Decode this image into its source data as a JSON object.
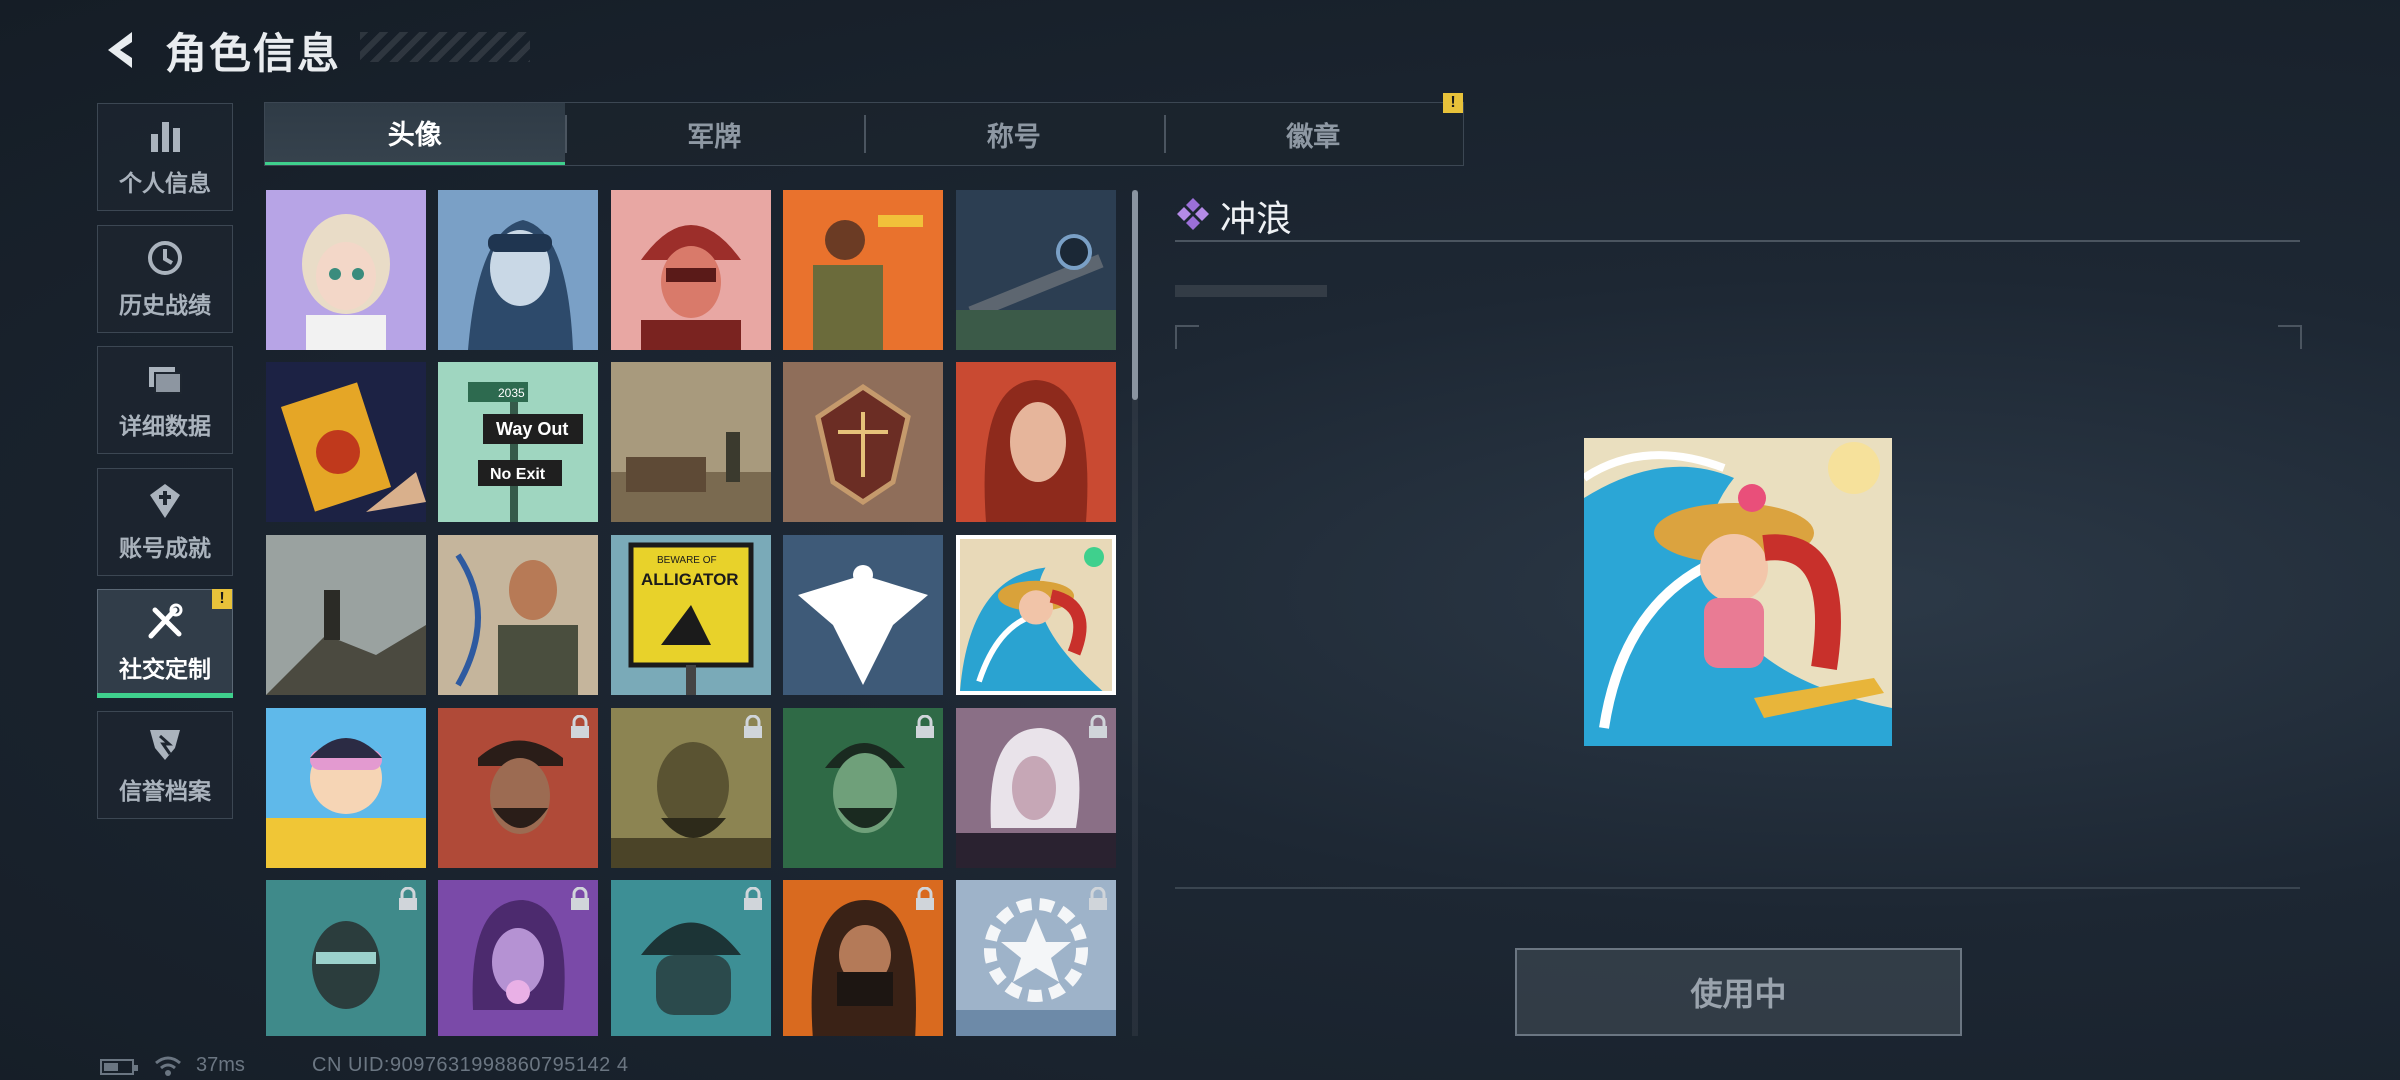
{
  "header": {
    "title": "角色信息",
    "back_icon": "back-arrow-icon"
  },
  "sidebar": {
    "items": [
      {
        "label": "个人信息",
        "icon": "bar-chart-icon",
        "active": false
      },
      {
        "label": "历史战绩",
        "icon": "history-clock-icon",
        "active": false
      },
      {
        "label": "详细数据",
        "icon": "folder-icon",
        "active": false
      },
      {
        "label": "账号成就",
        "icon": "achievement-icon",
        "active": false
      },
      {
        "label": "社交定制",
        "icon": "tools-icon",
        "active": true,
        "alert": "!"
      },
      {
        "label": "信誉档案",
        "icon": "credit-shield-icon",
        "active": false
      }
    ],
    "accent": "#3fd08d"
  },
  "tabs": [
    {
      "label": "头像",
      "active": true
    },
    {
      "label": "军牌",
      "active": false
    },
    {
      "label": "称号",
      "active": false
    },
    {
      "label": "徽章",
      "active": false,
      "alert": "!"
    }
  ],
  "avatars": [
    {
      "name": "girl-headset",
      "locked": false
    },
    {
      "name": "pilot-goggles",
      "locked": false
    },
    {
      "name": "red-helmet-soldier",
      "locked": false
    },
    {
      "name": "soldier-drone-orange",
      "locked": false
    },
    {
      "name": "sniper-rifle",
      "locked": false
    },
    {
      "name": "hand-card-flames",
      "locked": false
    },
    {
      "name": "road-signs",
      "locked": false,
      "texts": [
        "2035",
        "Way Out",
        "No Exit"
      ]
    },
    {
      "name": "desert-wreck-soldier",
      "locked": false
    },
    {
      "name": "scales-emblem",
      "locked": false
    },
    {
      "name": "red-hair-woman",
      "locked": false
    },
    {
      "name": "mountain-peak-soldier",
      "locked": false
    },
    {
      "name": "archer-woman",
      "locked": false
    },
    {
      "name": "alligator-sign",
      "locked": false,
      "texts": [
        "BEWARE OF",
        "ALLIGATOR"
      ]
    },
    {
      "name": "eagle-crest",
      "locked": false
    },
    {
      "name": "surfing-girl",
      "locked": false,
      "selected": true,
      "in_use": true
    },
    {
      "name": "chibi-goggles-girl",
      "locked": false
    },
    {
      "name": "bearded-cap-operator",
      "locked": true
    },
    {
      "name": "bald-headset-operator",
      "locked": true
    },
    {
      "name": "green-bearded-operator",
      "locked": true
    },
    {
      "name": "white-hair-operator",
      "locked": true
    },
    {
      "name": "glasses-operator",
      "locked": true
    },
    {
      "name": "bubblegum-operator",
      "locked": true
    },
    {
      "name": "masked-helmet-operator",
      "locked": true
    },
    {
      "name": "long-hair-masked-operator",
      "locked": true
    },
    {
      "name": "star-gear-emblem",
      "locked": true
    }
  ],
  "detail": {
    "name": "冲浪",
    "rarity_icon": "purple-diamond-icon",
    "button_label": "使用中"
  },
  "status_bar": {
    "ping": "37ms",
    "uid": "CN UID:9097631998860795142 4"
  }
}
